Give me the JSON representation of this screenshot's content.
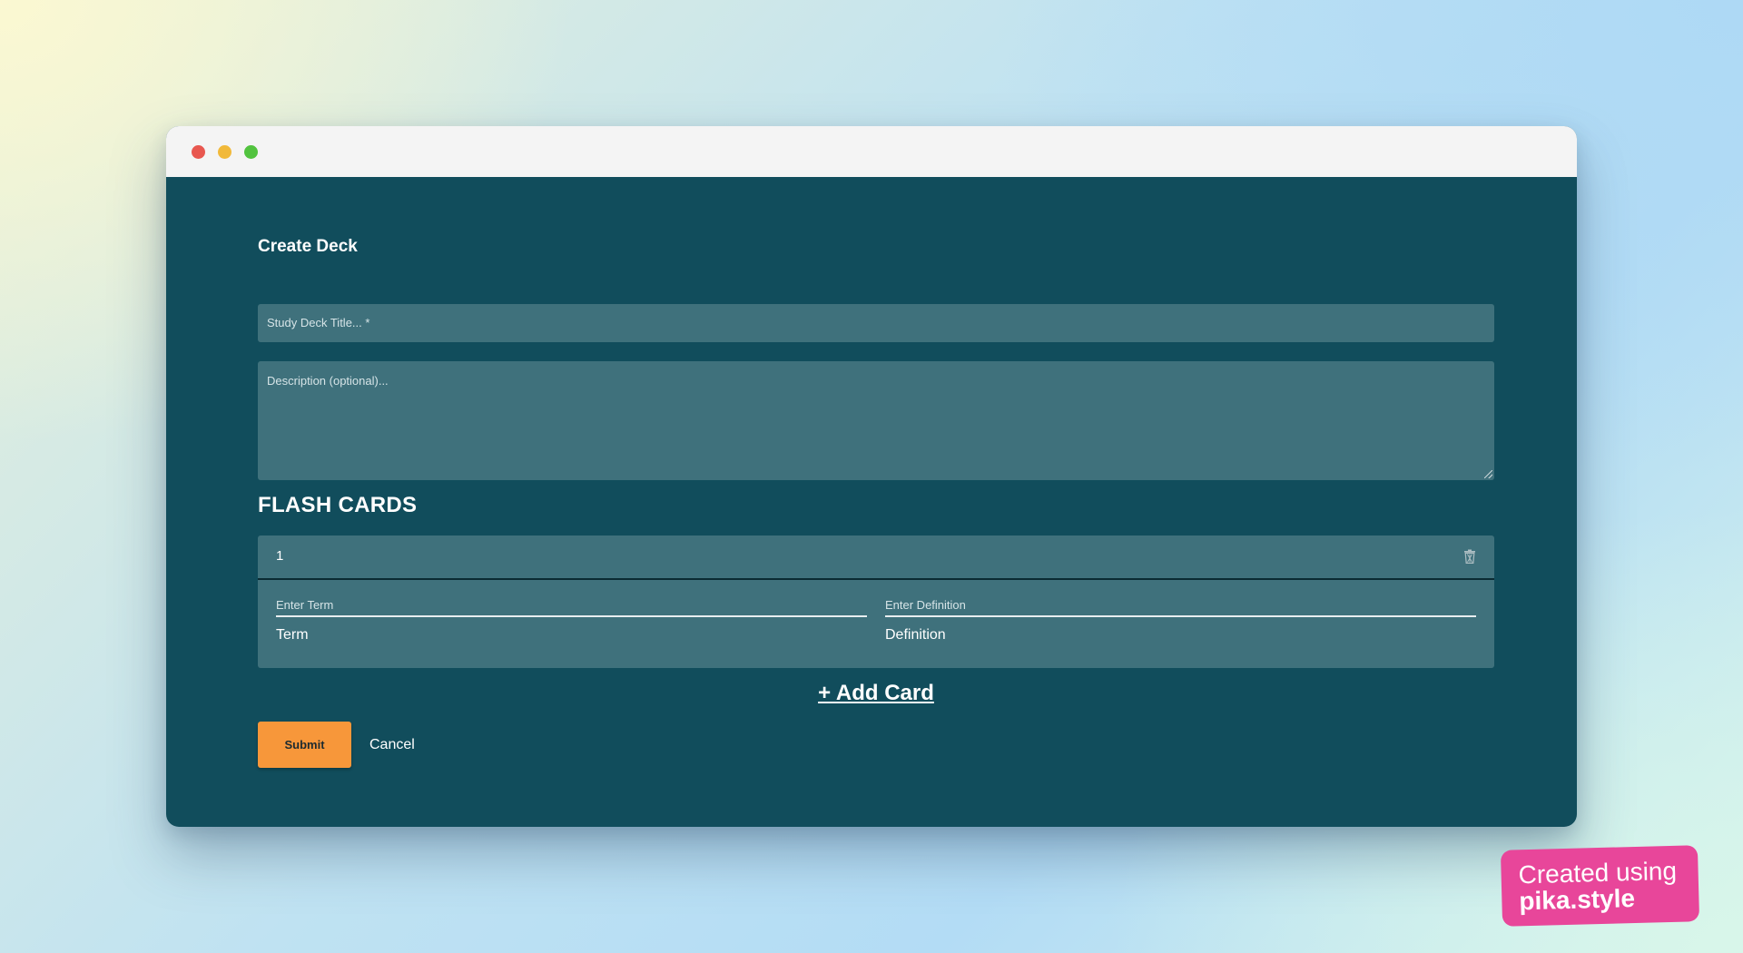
{
  "window": {
    "controls": [
      "close",
      "minimize",
      "maximize"
    ]
  },
  "form": {
    "title": "Create Deck",
    "title_placeholder": "Study Deck Title... *",
    "description_placeholder": "Description (optional)..."
  },
  "flashcards": {
    "heading": "FLASH CARDS",
    "cards": [
      {
        "number": "1",
        "term_label": "Enter Term",
        "term_value": "Term",
        "definition_label": "Enter Definition",
        "definition_value": "Definition"
      }
    ],
    "add_label": "+ Add Card"
  },
  "actions": {
    "submit_label": "Submit",
    "cancel_label": "Cancel"
  },
  "badge": {
    "line1": "Created using",
    "line2": "pika.style"
  },
  "colors": {
    "panel_bg": "#114d5c",
    "field_bg": "#3f717c",
    "submit_bg": "#f7973a",
    "badge_bg": "#e8469a"
  },
  "icons": {
    "card_delete": "trash-icon"
  }
}
